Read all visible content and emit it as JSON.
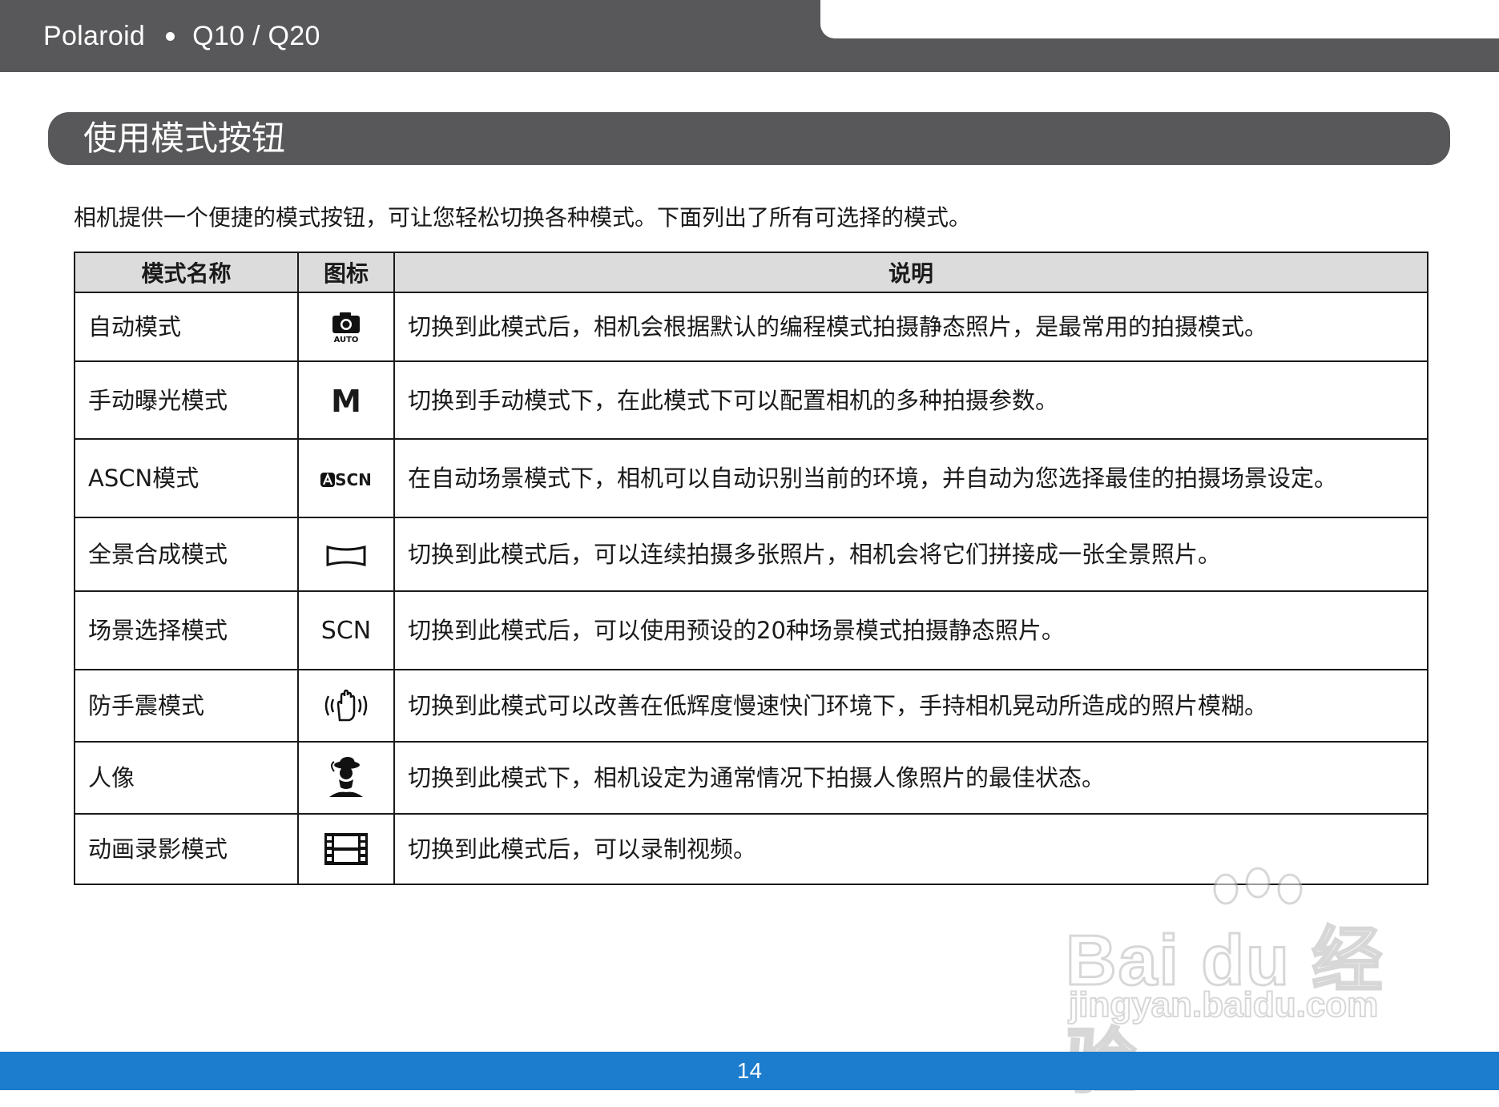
{
  "header": {
    "brand": "Polaroid",
    "model": "Q10 / Q20"
  },
  "section": {
    "title": "使用模式按钮"
  },
  "intro": "相机提供一个便捷的模式按钮，可让您轻松切换各种模式。下面列出了所有可选择的模式。",
  "table": {
    "headers": {
      "name": "模式名称",
      "icon": "图标",
      "desc": "说明"
    },
    "rows": [
      {
        "name": "自动模式",
        "icon": "camera-auto-icon",
        "icon_text": "AUTO",
        "desc": "切换到此模式后，相机会根据默认的编程模式拍摄静态照片，是最常用的拍摄模式。"
      },
      {
        "name": "手动曝光模式",
        "icon": "manual-m-icon",
        "icon_text": "M",
        "desc": "切换到手动模式下，在此模式下可以配置相机的多种拍摄参数。"
      },
      {
        "name": "ASCN模式",
        "icon": "ascn-icon",
        "icon_text": "SCN",
        "desc": "在自动场景模式下，相机可以自动识别当前的环境，并自动为您选择最佳的拍摄场景设定。"
      },
      {
        "name": "全景合成模式",
        "icon": "panorama-icon",
        "icon_text": "",
        "desc": "切换到此模式后，可以连续拍摄多张照片，相机会将它们拼接成一张全景照片。"
      },
      {
        "name": "场景选择模式",
        "icon": "scn-icon",
        "icon_text": "SCN",
        "desc": "切换到此模式后，可以使用预设的20种场景模式拍摄静态照片。"
      },
      {
        "name": "防手震模式",
        "icon": "anti-shake-hand-icon",
        "icon_text": "",
        "desc": "切换到此模式可以改善在低辉度慢速快门环境下，手持相机晃动所造成的照片模糊。"
      },
      {
        "name": "人像",
        "icon": "portrait-icon",
        "icon_text": "",
        "desc": "切换到此模式下，相机设定为通常情况下拍摄人像照片的最佳状态。"
      },
      {
        "name": "动画录影模式",
        "icon": "movie-film-icon",
        "icon_text": "",
        "desc": "切换到此模式后，可以录制视频。"
      }
    ]
  },
  "watermark": {
    "main": "Bai du 经验",
    "sub": "jingyan.baidu.com"
  },
  "footer": {
    "page_number": "14"
  }
}
